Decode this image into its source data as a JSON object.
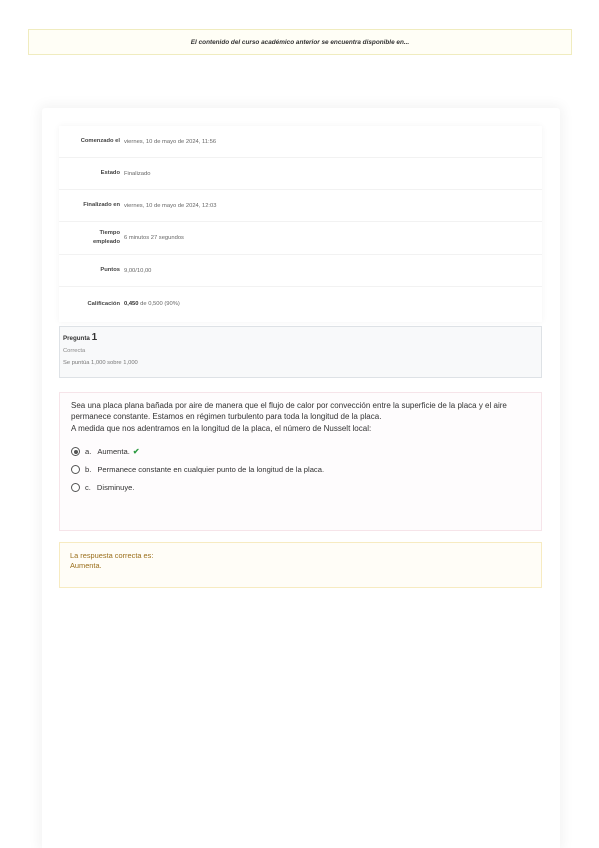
{
  "notice": {
    "text": "El contenido del curso académico anterior se encuentra disponible en..."
  },
  "summary": {
    "rows": [
      {
        "label": "Comenzado el",
        "value": "viernes, 10 de mayo de 2024, 11:56"
      },
      {
        "label": "Estado",
        "value": "Finalizado"
      },
      {
        "label": "Finalizado en",
        "value": "viernes, 10 de mayo de 2024, 12:03"
      },
      {
        "label_line1": "Tiempo",
        "label_line2": "empleado",
        "value": "6 minutos 27 segundos"
      },
      {
        "label": "Puntos",
        "value": "9,00/10,00"
      },
      {
        "label": "Calificación",
        "value_bold": "0,450",
        "value": "de 0,500 (90%)"
      }
    ]
  },
  "question": {
    "label": "Pregunta",
    "number": "1",
    "state": "Correcta",
    "grade": "Se puntúa 1,000 sobre 1,000",
    "text_1": "Sea una placa plana bañada por aire de manera que el flujo de calor por convección entre la superficie de la placa y el aire permanece constante. Estamos en régimen turbulento para toda la longitud de la placa.",
    "text_2": "A medida que nos adentramos en la longitud de la placa, el número de Nusselt local:",
    "options": [
      {
        "letter": "a.",
        "text": "Aumenta.",
        "selected": true,
        "correct_mark": "✔"
      },
      {
        "letter": "b.",
        "text": "Permanece constante en cualquier punto de la longitud de la placa."
      },
      {
        "letter": "c.",
        "text": "Disminuye."
      }
    ]
  },
  "feedback": {
    "line1": "La respuesta correcta es:",
    "line2": "Aumenta."
  },
  "colors": {
    "correct": "#2e9b43",
    "feedback_text": "#9a6e1a"
  }
}
